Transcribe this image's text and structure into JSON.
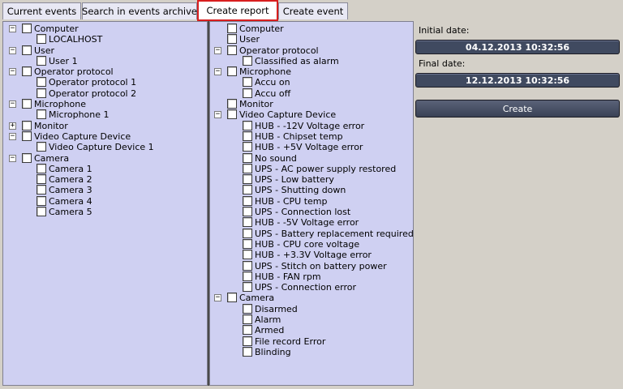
{
  "tabs": [
    {
      "label": "Current events"
    },
    {
      "label": "Search in events archive"
    },
    {
      "label": "Create report"
    },
    {
      "label": "Create event"
    }
  ],
  "objects_tree": [
    {
      "level": 0,
      "expander": "−",
      "label": "Computer"
    },
    {
      "level": 1,
      "expander": "",
      "label": "LOCALHOST"
    },
    {
      "level": 0,
      "expander": "−",
      "label": "User"
    },
    {
      "level": 1,
      "expander": "",
      "label": "User 1"
    },
    {
      "level": 0,
      "expander": "−",
      "label": "Operator protocol"
    },
    {
      "level": 1,
      "expander": "",
      "label": "Operator protocol 1"
    },
    {
      "level": 1,
      "expander": "",
      "label": "Operator protocol 2"
    },
    {
      "level": 0,
      "expander": "−",
      "label": "Microphone"
    },
    {
      "level": 1,
      "expander": "",
      "label": "Microphone 1"
    },
    {
      "level": 0,
      "expander": "+",
      "label": "Monitor"
    },
    {
      "level": 0,
      "expander": "−",
      "label": "Video Capture Device"
    },
    {
      "level": 1,
      "expander": "",
      "label": "Video Capture Device 1"
    },
    {
      "level": 0,
      "expander": "−",
      "label": "Camera"
    },
    {
      "level": 1,
      "expander": "",
      "label": "Camera 1"
    },
    {
      "level": 1,
      "expander": "",
      "label": "Camera 2"
    },
    {
      "level": 1,
      "expander": "",
      "label": "Camera 3"
    },
    {
      "level": 1,
      "expander": "",
      "label": "Camera 4"
    },
    {
      "level": 1,
      "expander": "",
      "label": "Camera 5"
    }
  ],
  "events_tree": [
    {
      "level": 0,
      "expander": "",
      "label": "Computer"
    },
    {
      "level": 0,
      "expander": "",
      "label": "User"
    },
    {
      "level": 0,
      "expander": "−",
      "label": "Operator protocol"
    },
    {
      "level": 1,
      "expander": "",
      "label": "Classified as alarm"
    },
    {
      "level": 0,
      "expander": "−",
      "label": "Microphone"
    },
    {
      "level": 1,
      "expander": "",
      "label": "Accu on"
    },
    {
      "level": 1,
      "expander": "",
      "label": "Accu off"
    },
    {
      "level": 0,
      "expander": "",
      "label": "Monitor"
    },
    {
      "level": 0,
      "expander": "−",
      "label": "Video Capture Device"
    },
    {
      "level": 1,
      "expander": "",
      "label": "HUB - -12V Voltage error"
    },
    {
      "level": 1,
      "expander": "",
      "label": "HUB - Chipset temp"
    },
    {
      "level": 1,
      "expander": "",
      "label": "HUB - +5V Voltage error"
    },
    {
      "level": 1,
      "expander": "",
      "label": "No sound"
    },
    {
      "level": 1,
      "expander": "",
      "label": "UPS - AC power supply restored"
    },
    {
      "level": 1,
      "expander": "",
      "label": "UPS - Low battery"
    },
    {
      "level": 1,
      "expander": "",
      "label": "UPS - Shutting down"
    },
    {
      "level": 1,
      "expander": "",
      "label": "HUB - CPU temp"
    },
    {
      "level": 1,
      "expander": "",
      "label": "UPS - Connection lost"
    },
    {
      "level": 1,
      "expander": "",
      "label": "HUB - -5V Voltage error"
    },
    {
      "level": 1,
      "expander": "",
      "label": "UPS - Battery replacement required"
    },
    {
      "level": 1,
      "expander": "",
      "label": "HUB - CPU core voltage"
    },
    {
      "level": 1,
      "expander": "",
      "label": "HUB - +3.3V Voltage error"
    },
    {
      "level": 1,
      "expander": "",
      "label": "UPS - Stitch on battery power"
    },
    {
      "level": 1,
      "expander": "",
      "label": "HUB - FAN rpm"
    },
    {
      "level": 1,
      "expander": "",
      "label": "UPS - Connection error"
    },
    {
      "level": 0,
      "expander": "−",
      "label": "Camera"
    },
    {
      "level": 1,
      "expander": "",
      "label": "Disarmed"
    },
    {
      "level": 1,
      "expander": "",
      "label": "Alarm"
    },
    {
      "level": 1,
      "expander": "",
      "label": "Armed"
    },
    {
      "level": 1,
      "expander": "",
      "label": "File record Error"
    },
    {
      "level": 1,
      "expander": "",
      "label": "Blinding"
    }
  ],
  "report": {
    "initial_label": "Initial date:",
    "initial_value": "04.12.2013 10:32:56",
    "final_label": "Final date:",
    "final_value": "12.12.2013 10:32:56",
    "create_label": "Create"
  }
}
